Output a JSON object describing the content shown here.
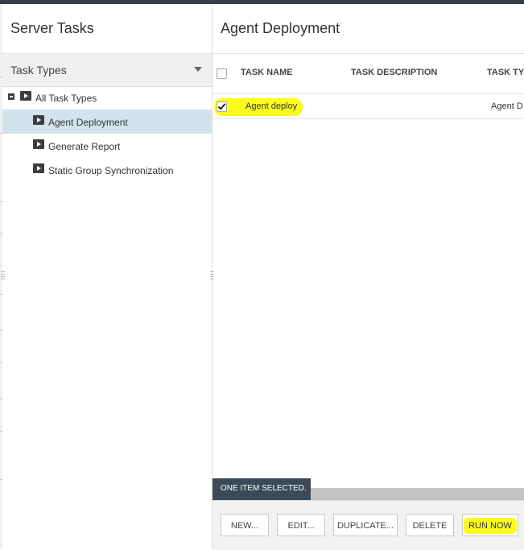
{
  "left_panel": {
    "title": "Server Tasks",
    "task_types_label": "Task Types",
    "tree": [
      {
        "label": "All Task Types"
      },
      {
        "label": "Agent Deployment",
        "selected": true
      },
      {
        "label": "Generate Report"
      },
      {
        "label": "Static Group Synchronization"
      }
    ]
  },
  "main": {
    "title": "Agent Deployment",
    "columns": [
      "TASK NAME",
      "TASK DESCRIPTION",
      "TASK TYP"
    ],
    "rows": [
      {
        "checked": true,
        "task_name": "Agent deploy",
        "task_description": "",
        "task_type": "Agent D"
      }
    ],
    "selection_status": "ONE ITEM SELECTED."
  },
  "footer": {
    "buttons": [
      "NEW...",
      "EDIT...",
      "DUPLICATE...",
      "DELETE",
      "RUN NOW"
    ]
  },
  "colors": {
    "highlight": "#fbfb1e",
    "selected_row": "#d3e3eb",
    "status_bar": "#3c4a57"
  },
  "icons": {
    "expander": "collapse-icon",
    "task_type": "play-icon",
    "dropdown": "chevron-down-icon"
  }
}
